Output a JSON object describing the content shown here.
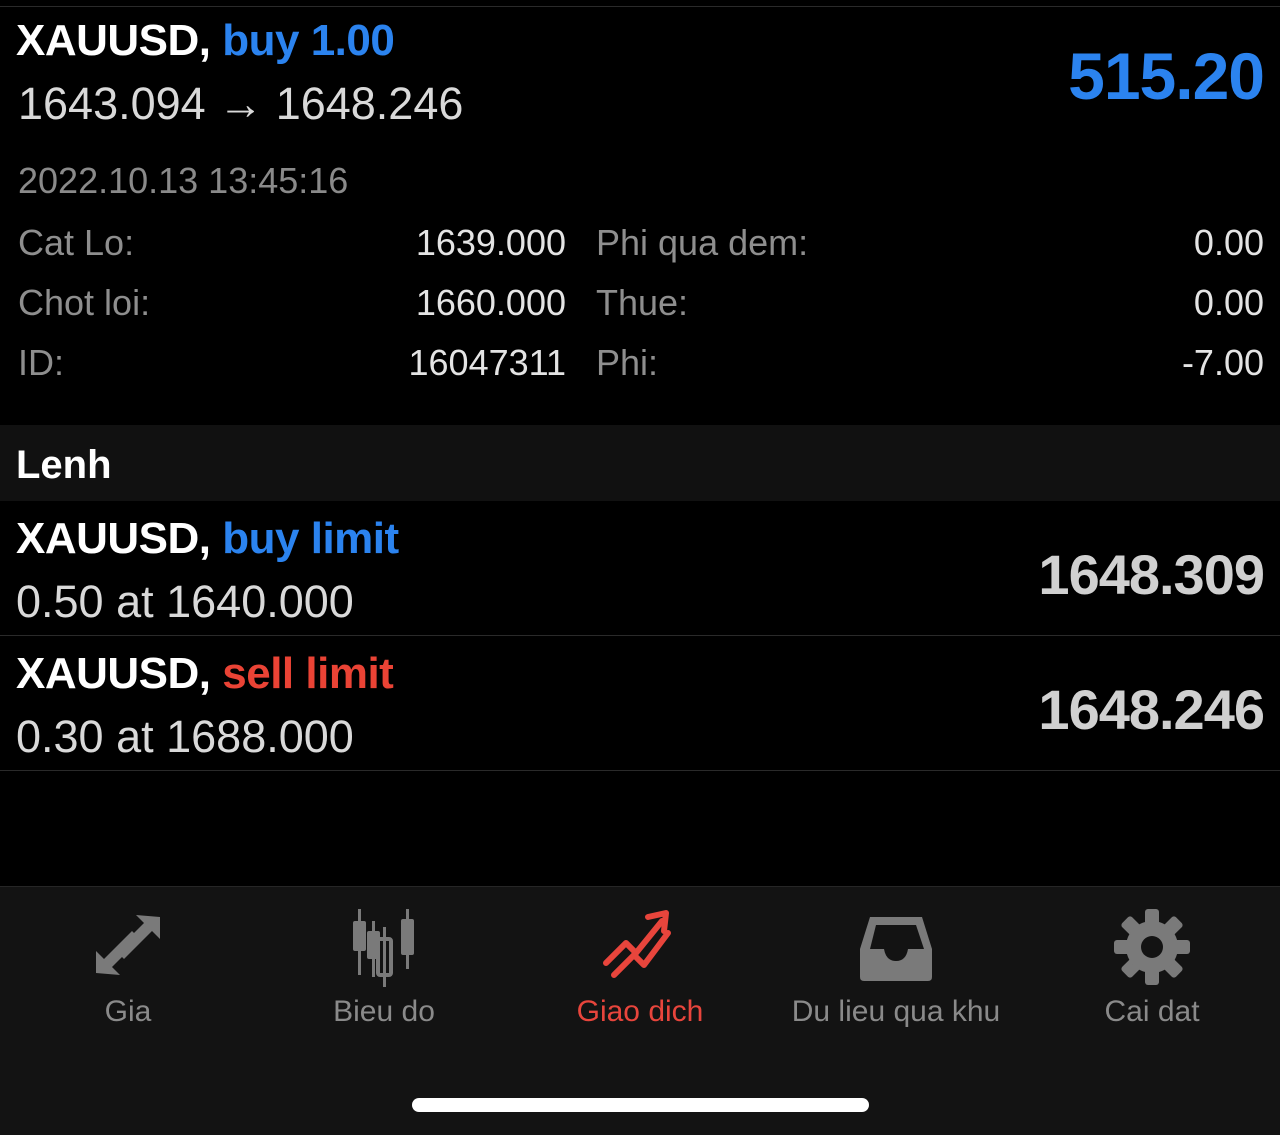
{
  "position": {
    "symbol": "XAUUSD,",
    "side": "buy 1.00",
    "prices": "1643.094 → 1648.246",
    "profit": "515.20",
    "time": "2022.10.13 13:45:16",
    "details": [
      {
        "label": "Cat Lo:",
        "value": "1639.000",
        "label2": "Phi qua dem:",
        "value2": "0.00"
      },
      {
        "label": "Chot loi:",
        "value": "1660.000",
        "label2": "Thue:",
        "value2": "0.00"
      },
      {
        "label": "ID:",
        "value": "16047311",
        "label2": "Phi:",
        "value2": "-7.00"
      }
    ]
  },
  "orders_section": {
    "title": "Lenh"
  },
  "orders": [
    {
      "symbol": "XAUUSD,",
      "type": "buy limit",
      "type_color": "#2b83ef",
      "detail": "0.50 at 1640.000",
      "price": "1648.309"
    },
    {
      "symbol": "XAUUSD,",
      "type": "sell limit",
      "type_color": "#ea4335",
      "detail": "0.30 at 1688.000",
      "price": "1648.246"
    }
  ],
  "tabs": [
    {
      "label": "Gia",
      "icon": "arrows-icon",
      "active": false
    },
    {
      "label": "Bieu do",
      "icon": "candlestick-icon",
      "active": false
    },
    {
      "label": "Giao dich",
      "icon": "trade-trend-icon",
      "active": true
    },
    {
      "label": "Du lieu qua khu",
      "icon": "inbox-icon",
      "active": false
    },
    {
      "label": "Cai dat",
      "icon": "gear-icon",
      "active": false
    }
  ],
  "colors": {
    "accent_blue": "#2b83ef",
    "accent_red": "#e8453c",
    "background": "#000000"
  }
}
